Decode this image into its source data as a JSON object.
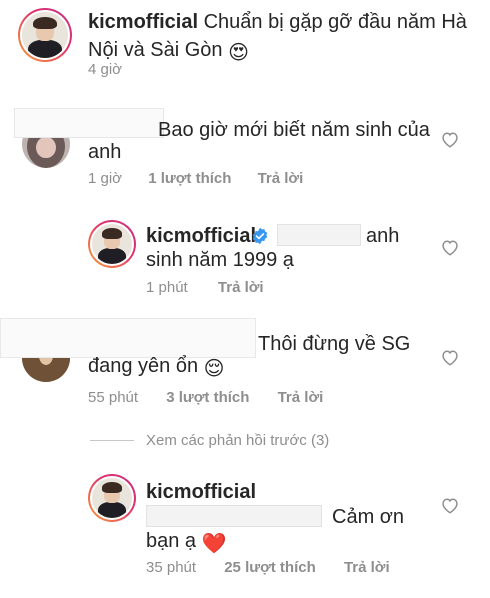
{
  "caption": {
    "username": "kicmofficial",
    "text_line1": "Chuẩn bị gặp gỡ đầu năm Hà",
    "text_line2": "Nội và Sài Gòn",
    "emoji": "😍",
    "time": "4 giờ"
  },
  "comments": [
    {
      "text_line1": "Bao giờ mới biết năm sinh của",
      "text_line2": "anh",
      "time": "1 giờ",
      "likes": "1 lượt thích",
      "reply": "Trả lời"
    },
    {
      "username": "kicmofficial",
      "verified": true,
      "text_line1": "anh",
      "text_line2": "sinh năm 1999 ạ",
      "time": "1 phút",
      "reply": "Trả lời"
    },
    {
      "text_line1": "Thôi đừng về SG",
      "text_line2": "đang yên ổn",
      "emoji": "😌",
      "time": "55 phút",
      "likes": "3 lượt thích",
      "reply": "Trả lời"
    },
    {
      "view_previous": "Xem các phản hồi trước (3)"
    },
    {
      "username": "kicmofficial",
      "text_line1": "Cảm ơn",
      "text_line2": "bạn ạ",
      "emoji": "❤️",
      "time": "35 phút",
      "likes": "25 lượt thích",
      "reply": "Trả lời"
    }
  ],
  "colors": {
    "text": "#262626",
    "meta": "#8e8e8e",
    "verified": "#3897f0",
    "heart": "#8e8e8e"
  },
  "icons": [
    "heart-outline-icon",
    "verified-badge-icon"
  ]
}
